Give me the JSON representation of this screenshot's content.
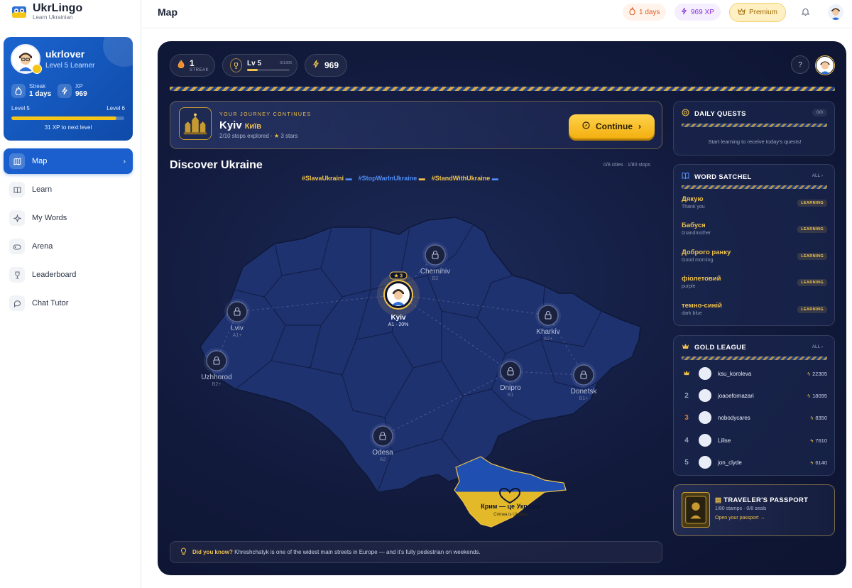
{
  "brand": {
    "name": "UkrLingo",
    "subtitle": "Learn Ukrainian"
  },
  "profile": {
    "username": "ukrlover",
    "level_title": "Level 5 Learner",
    "streak_label": "Streak",
    "streak_value": "1 days",
    "xp_label": "XP",
    "xp_value": "969",
    "level_from": "Level 5",
    "level_to": "Level 6",
    "level_progress": 0.93,
    "xp_to_next": "31 XP to next level"
  },
  "nav": [
    {
      "label": "Map",
      "icon": "map-icon",
      "active": true
    },
    {
      "label": "Learn",
      "icon": "book-icon"
    },
    {
      "label": "My Words",
      "icon": "sparkle-icon"
    },
    {
      "label": "Arena",
      "icon": "gamepad-icon"
    },
    {
      "label": "Leaderboard",
      "icon": "trophy-icon"
    },
    {
      "label": "Chat Tutor",
      "icon": "chat-icon"
    }
  ],
  "topbar": {
    "title": "Map",
    "streak": "1 days",
    "xp": "969 XP",
    "premium": "Premium"
  },
  "map_header": {
    "streak_value": "1",
    "streak_label": "STREAK",
    "level_label": "Lv 5",
    "level_progress_text": "0/1300",
    "xp_value": "969"
  },
  "journey": {
    "kicker": "YOUR JOURNEY CONTINUES",
    "city": "Kyiv",
    "city_native": "Київ",
    "meta": "2/10 stops explored · ",
    "stars": "3 stars",
    "button": "Continue"
  },
  "discover": {
    "title": "Discover Ukraine",
    "meta": "0/8 cities · 1/80 stops",
    "tags": [
      "#SlavaUkraini",
      "#StopWarInUkraine",
      "#StandWithUkraine"
    ]
  },
  "cities": [
    {
      "name": "Chernihiv",
      "level": "B2",
      "locked": true
    },
    {
      "name": "Kyiv",
      "level": "A1 · 20%",
      "locked": false,
      "stars": "3"
    },
    {
      "name": "Lviv",
      "level": "A1+",
      "locked": true
    },
    {
      "name": "Kharkiv",
      "level": "A2+",
      "locked": true
    },
    {
      "name": "Uzhhorod",
      "level": "B2+",
      "locked": true
    },
    {
      "name": "Dnipro",
      "level": "B1",
      "locked": true
    },
    {
      "name": "Donetsk",
      "level": "B1+",
      "locked": true
    },
    {
      "name": "Odesa",
      "level": "A2",
      "locked": true
    }
  ],
  "crimea": {
    "title": "Крим — це Україна",
    "subtitle": "Crimea is Ukraine"
  },
  "tip": {
    "label": "Did you know?",
    "text": "Khreshchatyk is one of the widest main streets in Europe — and it's fully pedestrian on weekends."
  },
  "daily_quests": {
    "title": "DAILY QUESTS",
    "count": "0/0",
    "empty": "Start learning to receive today's quests!"
  },
  "word_satchel": {
    "title": "WORD SATCHEL",
    "all": "ALL",
    "words": [
      {
        "uk": "Дякую",
        "en": "Thank you",
        "status": "LEARNING"
      },
      {
        "uk": "Бабуся",
        "en": "Grandmother",
        "status": "LEARNING"
      },
      {
        "uk": "Доброго ранку",
        "en": "Good morning",
        "status": "LEARNING"
      },
      {
        "uk": "фіолетовий",
        "en": "purple",
        "status": "LEARNING"
      },
      {
        "uk": "темно-синій",
        "en": "dark blue",
        "status": "LEARNING"
      }
    ]
  },
  "league": {
    "title": "GOLD LEAGUE",
    "all": "ALL",
    "rows": [
      {
        "rank": "",
        "name": "ksu_koroleva",
        "xp": "22305"
      },
      {
        "rank": "2",
        "name": "joaoefornazari",
        "xp": "18095"
      },
      {
        "rank": "3",
        "name": "nobodycares",
        "xp": "8350"
      },
      {
        "rank": "4",
        "name": "Lilise",
        "xp": "7610"
      },
      {
        "rank": "5",
        "name": "jon_clyde",
        "xp": "6140"
      }
    ]
  },
  "passport": {
    "title": "TRAVELER'S PASSPORT",
    "meta": "1/80 stamps · 0/8 seals",
    "link": "Open your passport →"
  },
  "colors": {
    "accent_blue": "#1a5fcd",
    "accent_gold": "#f0c24b",
    "map_bg": "#121a3c"
  }
}
